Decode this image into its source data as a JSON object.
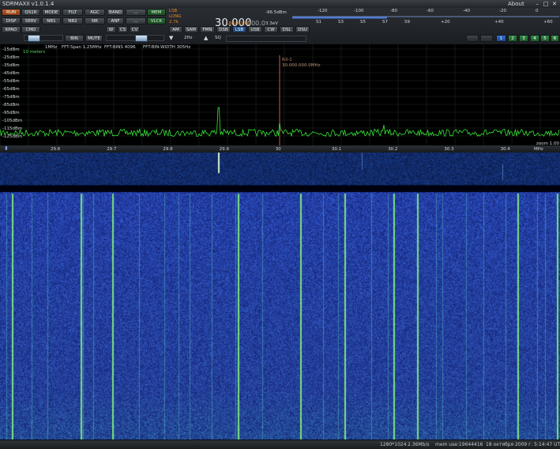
{
  "window": {
    "title": "SDRMAXII v1.0.1.4",
    "about": "About",
    "minimize": "–",
    "restore": "□",
    "close": "✕"
  },
  "panel": {
    "row1": [
      "RUN",
      "QS1R",
      "MODE",
      "FILT",
      "AGC",
      "BAND",
      "...",
      "MEM"
    ],
    "row2": [
      "DISP",
      "SERV",
      "NB1",
      "NB2",
      "NR",
      "ANF",
      "...",
      "VLCK"
    ],
    "row3_left": [
      "KPAD",
      "CMD"
    ],
    "row3_mid": [
      "W",
      "CS",
      "CV"
    ],
    "row4": [
      "BIN",
      "MUTE"
    ],
    "modes": [
      "AM",
      "SAM",
      "FMN",
      "DSB",
      "LSB",
      "USB",
      "CW",
      "DSL",
      "DSU"
    ],
    "mode_info": [
      "LSB",
      "LONG",
      "2.7k"
    ],
    "hz_label": "2Hz",
    "sq_label": "SQ",
    "freq_main": "30.000",
    "freq_sub": "000.0",
    "freq_status": "UNLOCKED",
    "voltage": "3.3eV",
    "dbm_readout": "-96.5dBm",
    "smeter_top": [
      "-120",
      "-100",
      "-80",
      "-60",
      "-40",
      "-20",
      "0"
    ],
    "smeter_bottom": [
      "S1",
      "S3",
      "S5",
      "S7",
      "S9",
      "+20",
      "+40",
      "+60"
    ],
    "panadapter_buttons": [
      "1",
      "2",
      "3",
      "4",
      "5",
      "6"
    ]
  },
  "spectrum": {
    "header": [
      "1MHz",
      "FFT-Span 1.25MHz",
      "FFT-BINS 4096",
      "FFT-BIN-WIDTH 305Hz"
    ],
    "band_label": "10 meters",
    "rx_label": "RX-1",
    "rx_freq": "30.000.000.0MHz",
    "db_labels": [
      "-15dBm",
      "-25dBm",
      "-35dBm",
      "-45dBm",
      "-55dBm",
      "-65dBm",
      "-75dBm",
      "-85dBm",
      "-95dBm",
      "-105dBm",
      "-115dBm",
      "-125dBm"
    ],
    "freq_ticks": [
      "29.6",
      "29.7",
      "29.8",
      "29.9",
      "30",
      "30.1",
      "30.2",
      "30.3",
      "30.4"
    ],
    "unit": "MHz",
    "zoom": "zoom 1.00"
  },
  "status": {
    "resolution": "1280*1024",
    "rate": "2.36Mb/s",
    "mem": "mem use:19644416",
    "datetime": "18 октября 2009 г. 5:14:47 UTC"
  },
  "colors": {
    "accent_orange": "#c2612c",
    "spectrum_trace": "#39e639",
    "waterfall_bg": "#1b2f8a"
  }
}
